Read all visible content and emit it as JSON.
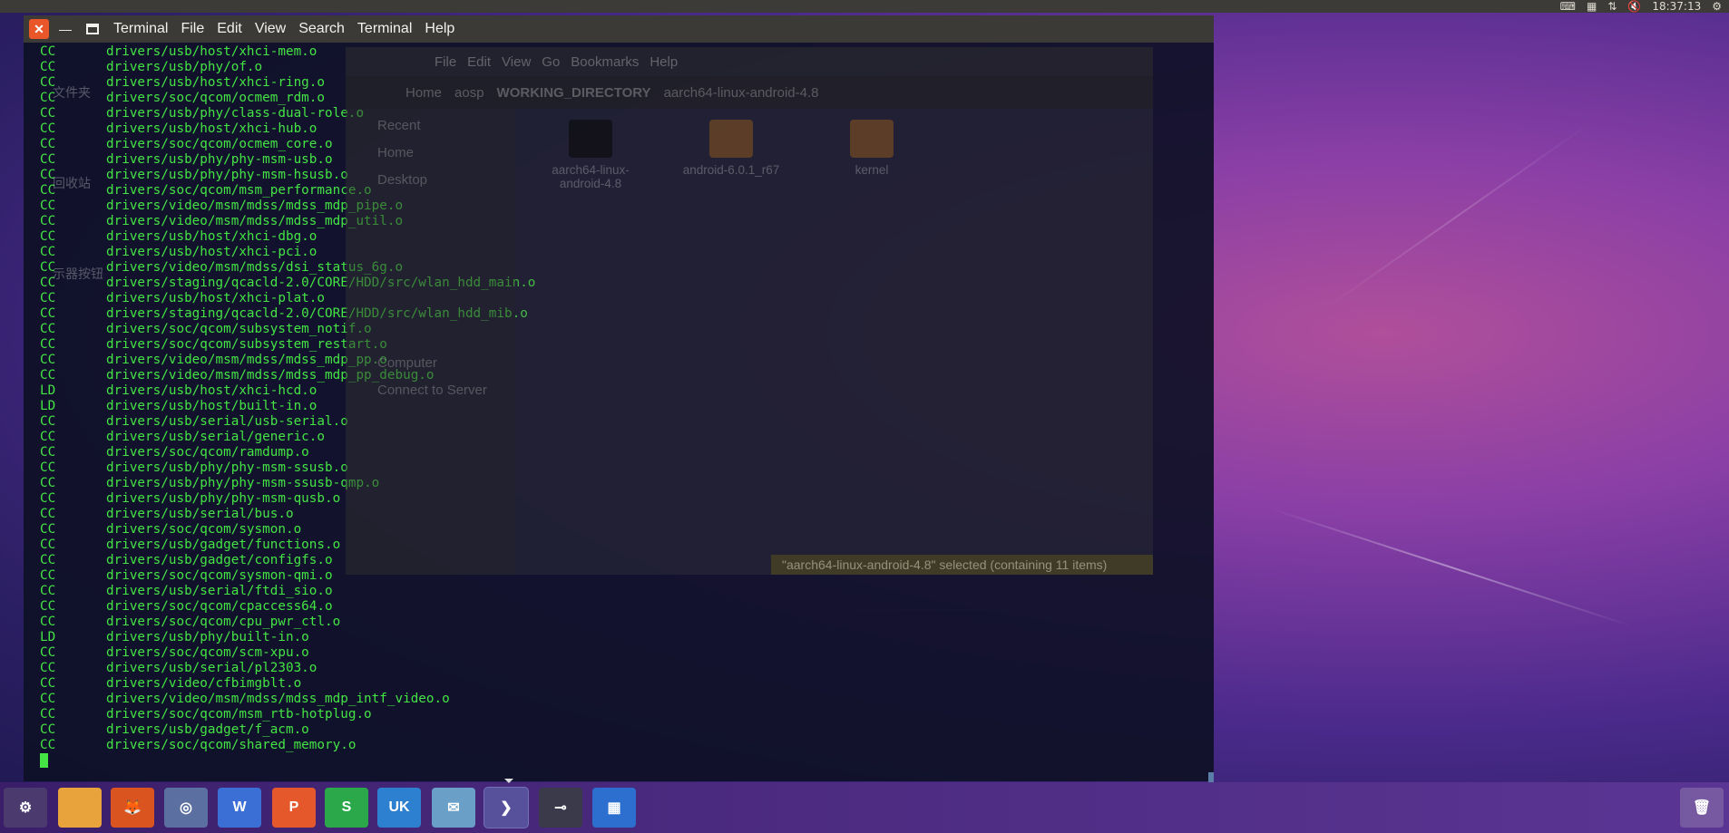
{
  "top_panel": {
    "time": "18:37:13",
    "tray_icons": [
      "keyboard-icon",
      "input-method-icon",
      "network-icon",
      "volume-mute-icon",
      "gear-icon"
    ]
  },
  "terminal": {
    "menu": [
      "Terminal",
      "File",
      "Edit",
      "View",
      "Search",
      "Terminal",
      "Help"
    ],
    "lines": [
      {
        "tag": "CC",
        "path": "drivers/usb/host/xhci-mem.o"
      },
      {
        "tag": "CC",
        "path": "drivers/usb/phy/of.o"
      },
      {
        "tag": "CC",
        "path": "drivers/usb/host/xhci-ring.o"
      },
      {
        "tag": "CC",
        "path": "drivers/soc/qcom/ocmem_rdm.o"
      },
      {
        "tag": "CC",
        "path": "drivers/usb/phy/class-dual-role.o"
      },
      {
        "tag": "CC",
        "path": "drivers/usb/host/xhci-hub.o"
      },
      {
        "tag": "CC",
        "path": "drivers/soc/qcom/ocmem_core.o"
      },
      {
        "tag": "CC",
        "path": "drivers/usb/phy/phy-msm-usb.o"
      },
      {
        "tag": "CC",
        "path": "drivers/usb/phy/phy-msm-hsusb.o"
      },
      {
        "tag": "CC",
        "path": "drivers/soc/qcom/msm_performance.o"
      },
      {
        "tag": "CC",
        "path": "drivers/video/msm/mdss/mdss_mdp_pipe.o"
      },
      {
        "tag": "CC",
        "path": "drivers/video/msm/mdss/mdss_mdp_util.o"
      },
      {
        "tag": "CC",
        "path": "drivers/usb/host/xhci-dbg.o"
      },
      {
        "tag": "CC",
        "path": "drivers/usb/host/xhci-pci.o"
      },
      {
        "tag": "CC",
        "path": "drivers/video/msm/mdss/dsi_status_6g.o"
      },
      {
        "tag": "CC",
        "path": "drivers/staging/qcacld-2.0/CORE/HDD/src/wlan_hdd_main.o"
      },
      {
        "tag": "CC",
        "path": "drivers/usb/host/xhci-plat.o"
      },
      {
        "tag": "CC",
        "path": "drivers/staging/qcacld-2.0/CORE/HDD/src/wlan_hdd_mib.o"
      },
      {
        "tag": "CC",
        "path": "drivers/soc/qcom/subsystem_notif.o"
      },
      {
        "tag": "CC",
        "path": "drivers/soc/qcom/subsystem_restart.o"
      },
      {
        "tag": "CC",
        "path": "drivers/video/msm/mdss/mdss_mdp_pp.o"
      },
      {
        "tag": "CC",
        "path": "drivers/video/msm/mdss/mdss_mdp_pp_debug.o"
      },
      {
        "tag": "LD",
        "path": "drivers/usb/host/xhci-hcd.o"
      },
      {
        "tag": "LD",
        "path": "drivers/usb/host/built-in.o"
      },
      {
        "tag": "CC",
        "path": "drivers/usb/serial/usb-serial.o"
      },
      {
        "tag": "CC",
        "path": "drivers/usb/serial/generic.o"
      },
      {
        "tag": "CC",
        "path": "drivers/soc/qcom/ramdump.o"
      },
      {
        "tag": "CC",
        "path": "drivers/usb/phy/phy-msm-ssusb.o"
      },
      {
        "tag": "CC",
        "path": "drivers/usb/phy/phy-msm-ssusb-qmp.o"
      },
      {
        "tag": "CC",
        "path": "drivers/usb/phy/phy-msm-qusb.o"
      },
      {
        "tag": "CC",
        "path": "drivers/usb/serial/bus.o"
      },
      {
        "tag": "CC",
        "path": "drivers/soc/qcom/sysmon.o"
      },
      {
        "tag": "CC",
        "path": "drivers/usb/gadget/functions.o"
      },
      {
        "tag": "CC",
        "path": "drivers/usb/gadget/configfs.o"
      },
      {
        "tag": "CC",
        "path": "drivers/soc/qcom/sysmon-qmi.o"
      },
      {
        "tag": "CC",
        "path": "drivers/usb/serial/ftdi_sio.o"
      },
      {
        "tag": "CC",
        "path": "drivers/soc/qcom/cpaccess64.o"
      },
      {
        "tag": "CC",
        "path": "drivers/soc/qcom/cpu_pwr_ctl.o"
      },
      {
        "tag": "LD",
        "path": "drivers/usb/phy/built-in.o"
      },
      {
        "tag": "CC",
        "path": "drivers/soc/qcom/scm-xpu.o"
      },
      {
        "tag": "CC",
        "path": "drivers/usb/serial/pl2303.o"
      },
      {
        "tag": "CC",
        "path": "drivers/video/cfbimgblt.o"
      },
      {
        "tag": "CC",
        "path": "drivers/video/msm/mdss/mdss_mdp_intf_video.o"
      },
      {
        "tag": "CC",
        "path": "drivers/soc/qcom/msm_rtb-hotplug.o"
      },
      {
        "tag": "CC",
        "path": "drivers/usb/gadget/f_acm.o"
      },
      {
        "tag": "CC",
        "path": "drivers/soc/qcom/shared_memory.o"
      }
    ]
  },
  "files_window": {
    "menu": [
      "File",
      "Edit",
      "View",
      "Go",
      "Bookmarks",
      "Help"
    ],
    "breadcrumb": [
      "Home",
      "aosp",
      "WORKING_DIRECTORY",
      "aarch64-linux-android-4.8"
    ],
    "sidebar": [
      "Recent",
      "Home",
      "Desktop",
      "Computer",
      "Connect to Server"
    ],
    "items": [
      "aarch64-linux-android-4.8",
      "android-6.0.1_r67",
      "kernel"
    ],
    "status": "\"aarch64-linux-android-4.8\" selected  (containing 11 items)"
  },
  "desktop_icons": [
    "文件夹",
    "回收站",
    "示器按钮"
  ],
  "dock": {
    "items": [
      {
        "name": "ubuntu-settings-icon",
        "label": ""
      },
      {
        "name": "files-icon",
        "label": ""
      },
      {
        "name": "firefox-icon",
        "label": ""
      },
      {
        "name": "chromium-icon",
        "label": ""
      },
      {
        "name": "wps-writer-icon",
        "label": "W"
      },
      {
        "name": "wps-presentation-icon",
        "label": "P"
      },
      {
        "name": "wps-spreadsheet-icon",
        "label": "S"
      },
      {
        "name": "ubuntu-kylin-store-icon",
        "label": "UK"
      },
      {
        "name": "archive-manager-icon",
        "label": ""
      },
      {
        "name": "terminal-icon",
        "label": ""
      },
      {
        "name": "screen-recorder-icon",
        "label": ""
      },
      {
        "name": "workspace-switcher-icon",
        "label": ""
      }
    ],
    "trash": "trash-icon"
  }
}
